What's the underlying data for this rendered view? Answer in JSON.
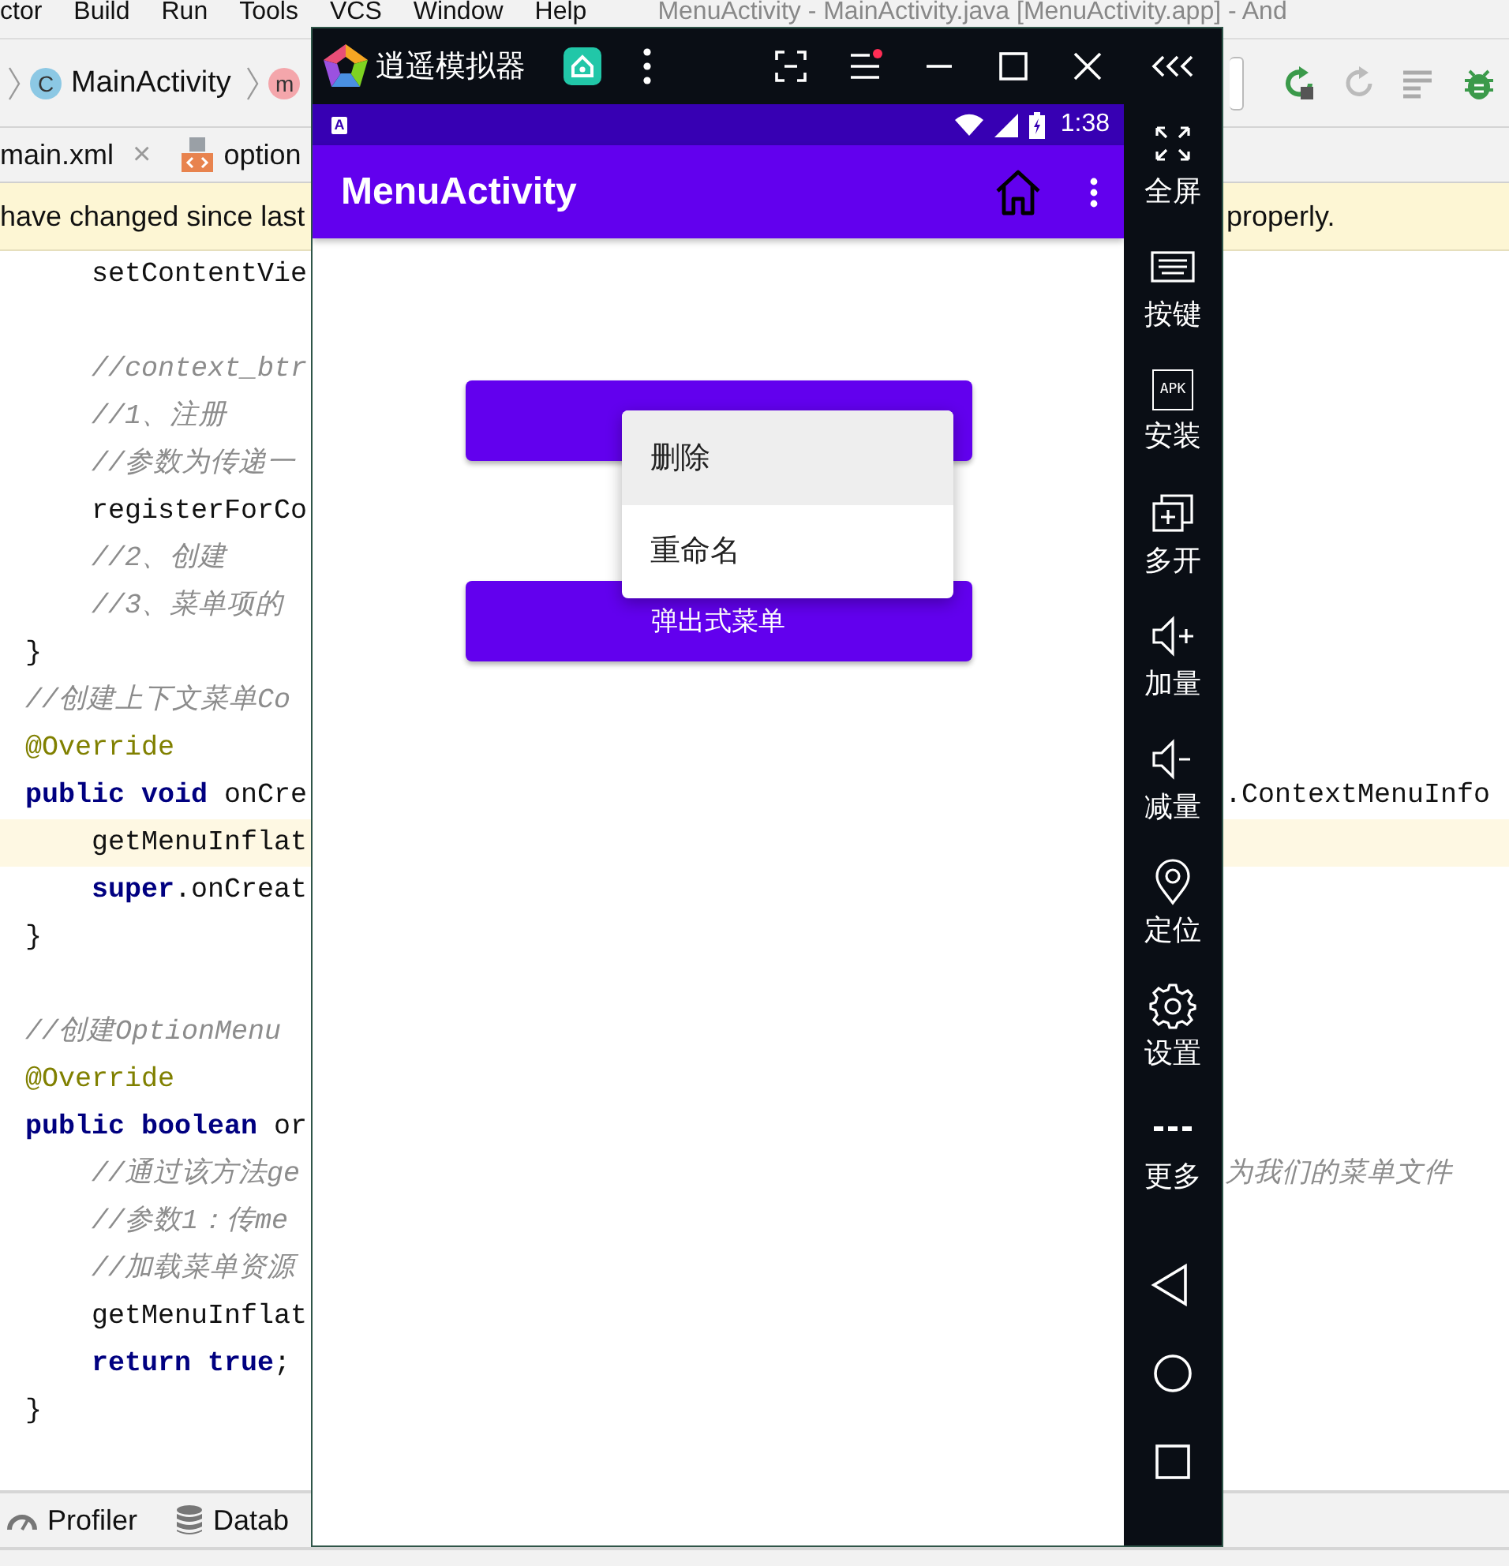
{
  "ide": {
    "menu_bar": [
      "ctor",
      "Build",
      "Run",
      "Tools",
      "VCS",
      "Window",
      "Help"
    ],
    "title": "MenuActivity - MainActivity.java [MenuActivity.app] - And",
    "breadcrumbs": [
      {
        "kind": "class",
        "badge": "C",
        "label": "MainActivity"
      },
      {
        "kind": "method",
        "badge": "m"
      }
    ],
    "tabs": [
      {
        "kind": "plain",
        "label": "main.xml",
        "selected": false,
        "close": "×"
      },
      {
        "kind": "xml",
        "label": "option",
        "selected": false
      }
    ],
    "banner": {
      "left": "have changed since last",
      "right": "properly."
    },
    "code_lines": [
      {
        "kind": "code",
        "indented": true,
        "text": "setContentVie"
      },
      {
        "kind": "blank"
      },
      {
        "kind": "comment",
        "indented": true,
        "text": "//context_btr"
      },
      {
        "kind": "comment",
        "indented": true,
        "text": "//1、注册"
      },
      {
        "kind": "comment",
        "indented": true,
        "text": "//参数为传递一"
      },
      {
        "kind": "code",
        "indented": true,
        "text": "registerForCo"
      },
      {
        "kind": "comment",
        "indented": true,
        "text": "//2、创建"
      },
      {
        "kind": "comment",
        "indented": true,
        "text": "//3、菜单项的"
      },
      {
        "kind": "code",
        "indented": false,
        "text": "}"
      },
      {
        "kind": "comment",
        "indented": false,
        "text": "//创建上下文菜单Co"
      },
      {
        "kind": "annotation",
        "indented": false,
        "text": "@Override"
      },
      {
        "kind": "code",
        "indented": false,
        "text": "**public** **void** onCre",
        "right": ".ContextMenuInfo"
      },
      {
        "kind": "code",
        "indented": true,
        "text": "getMenuInflat",
        "highlighted": true
      },
      {
        "kind": "code",
        "indented": true,
        "text": "**super**.onCreat"
      },
      {
        "kind": "code",
        "indented": false,
        "text": "}"
      },
      {
        "kind": "blank"
      },
      {
        "kind": "comment",
        "indented": false,
        "text": "//创建OptionMenu"
      },
      {
        "kind": "annotation",
        "indented": false,
        "text": "@Override"
      },
      {
        "kind": "code",
        "indented": false,
        "text": "**public** **boolean** or"
      },
      {
        "kind": "comment",
        "indented": true,
        "text": "//通过该方法ge",
        "right": "为我们的菜单文件"
      },
      {
        "kind": "comment",
        "indented": true,
        "text": "//参数1：传me"
      },
      {
        "kind": "comment",
        "indented": true,
        "text": "//加载菜单资源"
      },
      {
        "kind": "code",
        "indented": true,
        "text": "getMenuInflat"
      },
      {
        "kind": "code",
        "indented": true,
        "text": "**return** **true**;"
      },
      {
        "kind": "code",
        "indented": false,
        "text": "}"
      }
    ],
    "tool_windows": [
      {
        "kind": "profiler",
        "label": "Profiler"
      },
      {
        "kind": "database",
        "label": "Datab"
      }
    ]
  },
  "emulator": {
    "title": "逍遥模拟器",
    "title_buttons": [
      {
        "kind": "fullscreen"
      },
      {
        "kind": "menu",
        "notification": true
      },
      {
        "kind": "minimize"
      },
      {
        "kind": "maximize"
      },
      {
        "kind": "close"
      },
      {
        "kind": "collapse"
      }
    ],
    "status_bar": {
      "notification": "A",
      "time": "1:38"
    },
    "app_bar": {
      "title": "MenuActivity"
    },
    "buttons": [
      {
        "kind": "button"
      },
      {
        "kind": "button",
        "label": "弹出式菜单"
      }
    ],
    "context_menu": [
      {
        "label": "删除",
        "selected": true
      },
      {
        "label": "重命名",
        "selected": false
      }
    ],
    "sidebar": [
      {
        "kind": "fullscreen",
        "label": "全屏"
      },
      {
        "kind": "keyboard",
        "label": "按键"
      },
      {
        "kind": "apk",
        "badge": "APK",
        "label": "安装"
      },
      {
        "kind": "multi",
        "label": "多开"
      },
      {
        "kind": "volume-up",
        "label": "加量"
      },
      {
        "kind": "volume-down",
        "label": "减量"
      },
      {
        "kind": "location",
        "label": "定位"
      },
      {
        "kind": "settings",
        "label": "设置"
      },
      {
        "kind": "more",
        "label": "更多"
      }
    ],
    "nav_keys": [
      {
        "kind": "back"
      },
      {
        "kind": "home"
      },
      {
        "kind": "recent"
      }
    ]
  }
}
